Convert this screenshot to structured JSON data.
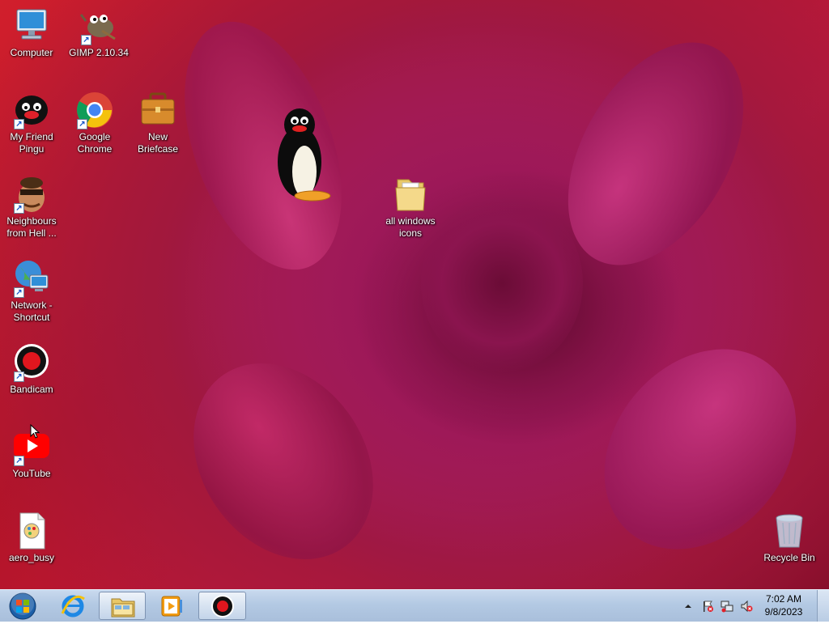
{
  "desktop": {
    "icons": [
      {
        "id": "computer",
        "label": "Computer"
      },
      {
        "id": "gimp",
        "label": "GIMP 2.10.34"
      },
      {
        "id": "pingu",
        "label": "My Friend Pingu"
      },
      {
        "id": "chrome",
        "label": "Google Chrome"
      },
      {
        "id": "briefcase",
        "label": "New Briefcase"
      },
      {
        "id": "neighbours",
        "label": "Neighbours from Hell ..."
      },
      {
        "id": "folder",
        "label": "all windows icons"
      },
      {
        "id": "network",
        "label": "Network - Shortcut"
      },
      {
        "id": "bandicam",
        "label": "Bandicam"
      },
      {
        "id": "youtube",
        "label": "YouTube"
      },
      {
        "id": "aero_busy",
        "label": "aero_busy"
      },
      {
        "id": "recycle",
        "label": "Recycle Bin"
      }
    ]
  },
  "taskbar": {
    "buttons": [
      "start-orb",
      "internet-explorer",
      "windows-explorer",
      "media-player",
      "bandicam"
    ],
    "tray": {
      "icons": [
        "show-hidden-icons-arrow",
        "action-center-flag-icon",
        "network-icon",
        "volume-muted-icon"
      ],
      "time": "7:02 AM",
      "date": "9/8/2023"
    }
  },
  "colors": {
    "wallpaper_red": "#c21a3a",
    "wallpaper_magenta": "#a0185e",
    "taskbar": "#b3c9e3"
  }
}
